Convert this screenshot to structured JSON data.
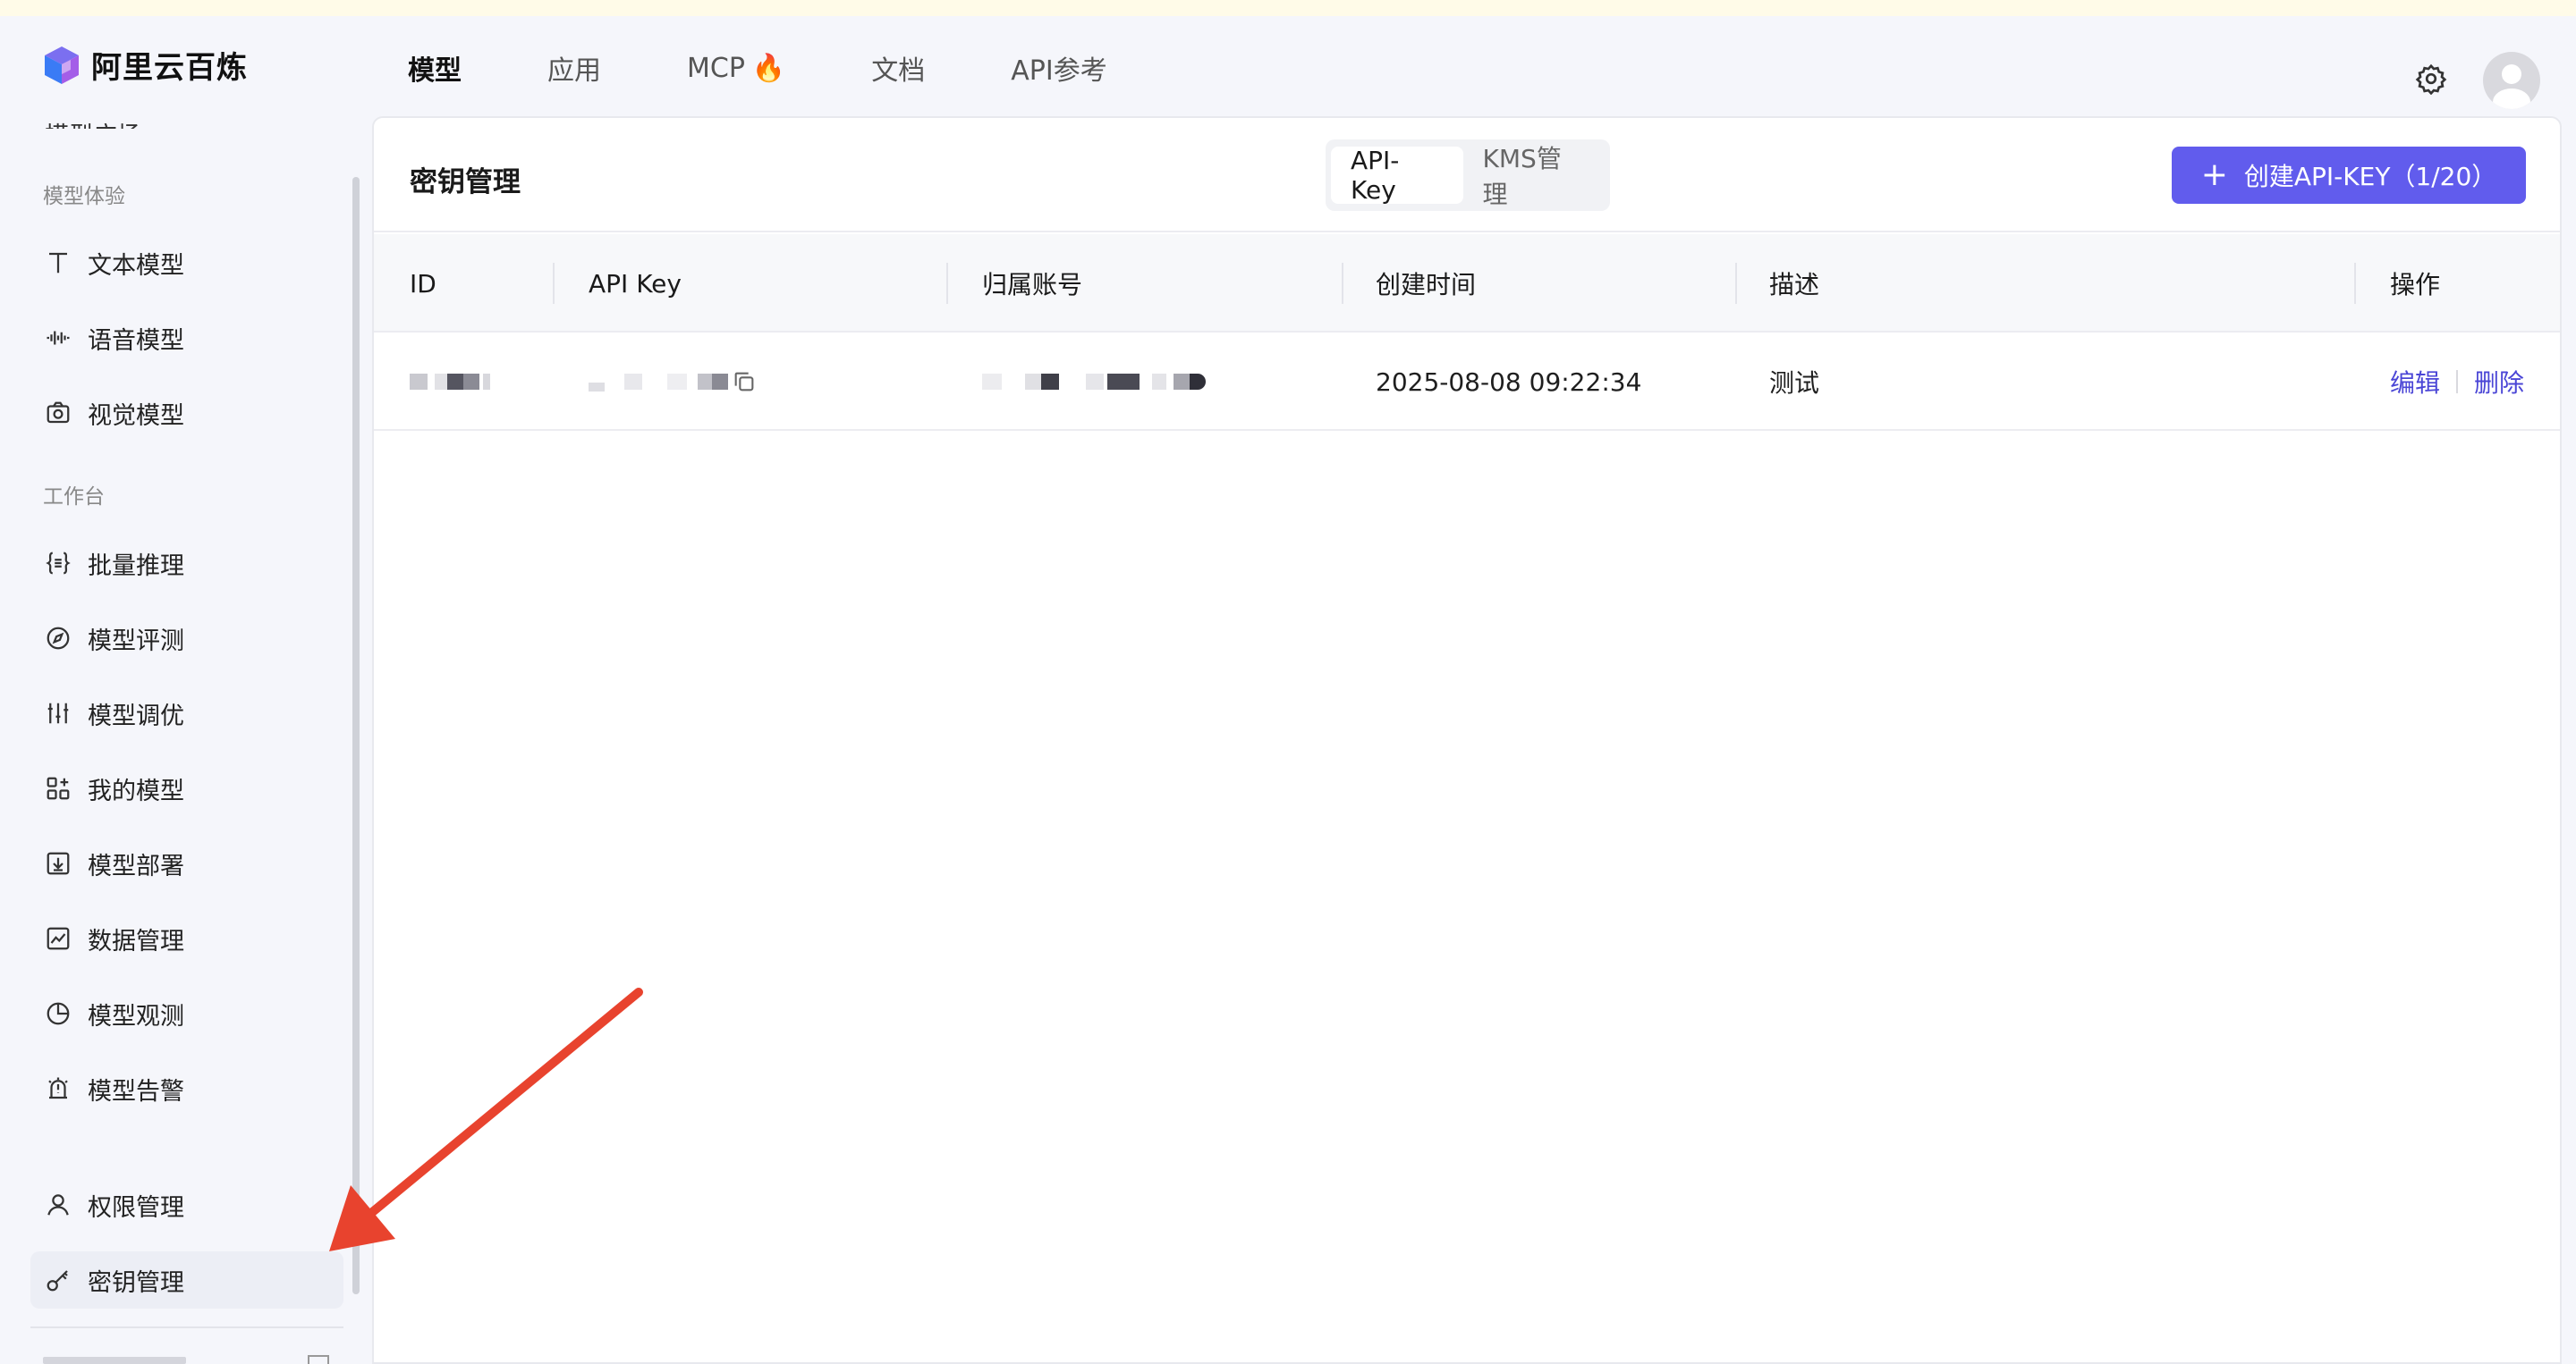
{
  "brand": {
    "name": "阿里云百炼"
  },
  "topnav": [
    {
      "label": "模型",
      "active": true
    },
    {
      "label": "应用",
      "active": false
    },
    {
      "label": "MCP",
      "active": false,
      "badge": "🔥"
    },
    {
      "label": "文档",
      "active": false
    },
    {
      "label": "API参考",
      "active": false
    }
  ],
  "sidebar": {
    "partial_item": "模型广场",
    "group_experience": "模型体验",
    "items_experience": [
      "文本模型",
      "语音模型",
      "视觉模型"
    ],
    "group_workbench": "工作台",
    "items_workbench": [
      "批量推理",
      "模型评测",
      "模型调优",
      "我的模型",
      "模型部署",
      "数据管理",
      "模型观测",
      "模型告警"
    ],
    "items_admin": [
      "权限管理",
      "密钥管理"
    ],
    "active_item": "密钥管理"
  },
  "main": {
    "title": "密钥管理",
    "tabs": [
      {
        "label": "API-Key",
        "active": true
      },
      {
        "label": "KMS管理",
        "active": false
      }
    ],
    "create_button": "创建API-KEY（1/20）"
  },
  "table": {
    "columns": [
      "ID",
      "API Key",
      "归属账号",
      "创建时间",
      "描述",
      "操作"
    ],
    "rows": [
      {
        "id": "",
        "api_key": "",
        "account": "",
        "created": "2025-08-08 09:22:34",
        "description": "测试",
        "actions": [
          "编辑",
          "删除"
        ]
      }
    ]
  },
  "colors": {
    "accent": "#615ced",
    "link": "#4b46d6",
    "annotation_arrow": "#e8432e"
  }
}
